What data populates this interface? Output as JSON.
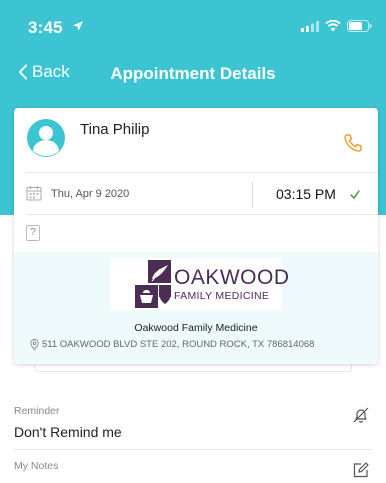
{
  "status_bar": {
    "time": "3:45"
  },
  "nav": {
    "back_label": "Back",
    "title": "Appointment Details"
  },
  "appointment": {
    "patient_name": "Tina Philip",
    "date": "Thu, Apr 9  2020",
    "time": "03:15 PM",
    "question_mark": "?"
  },
  "clinic": {
    "logo_line1": "OAKWOOD",
    "logo_line2": "FAMILY MEDICINE",
    "name": "Oakwood Family Medicine",
    "address": "511 OAKWOOD BLVD STE 202, ROUND ROCK, TX 786814068"
  },
  "reminder": {
    "label": "Reminder",
    "value": "Don't Remind me"
  },
  "notes": {
    "label": "My Notes"
  },
  "colors": {
    "header_teal": "#3cc4d3",
    "phone_orange": "#f0a030",
    "check_green": "#3aa04a",
    "logo_purple": "#4b2d55"
  },
  "icons": {
    "location": "location-pin-icon",
    "calendar": "calendar-icon",
    "reminder": "reminder-bell-icon",
    "notes": "edit-note-icon"
  }
}
